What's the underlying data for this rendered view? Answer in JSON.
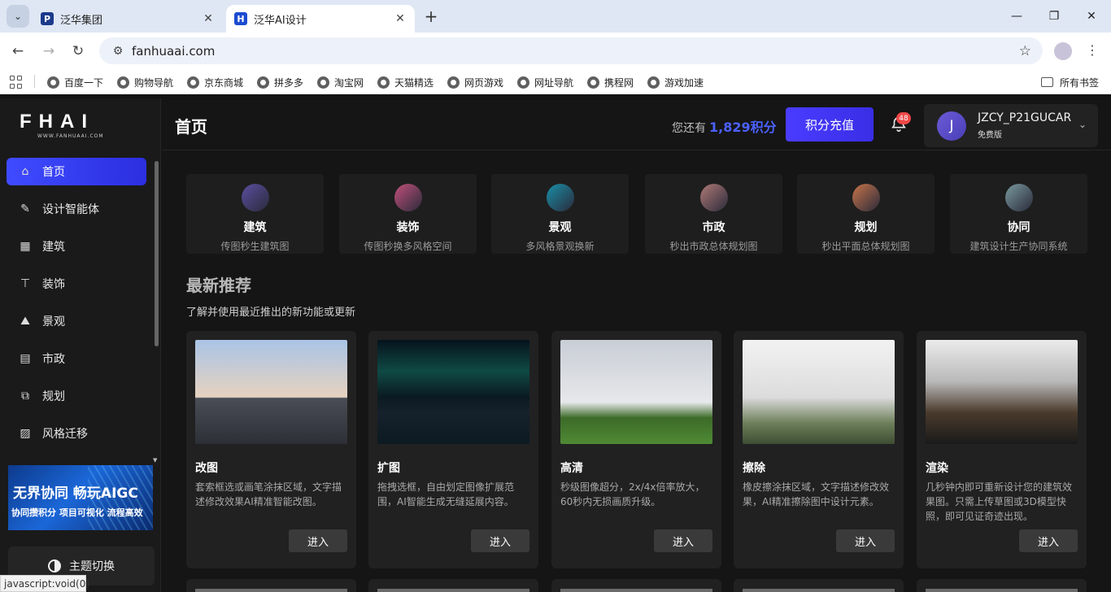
{
  "browser": {
    "tabs": [
      {
        "title": "泛华集团",
        "fav": "P"
      },
      {
        "title": "泛华AI设计",
        "fav": "H"
      }
    ],
    "url": "fanhuaai.com",
    "bookmarks": [
      "百度一下",
      "购物导航",
      "京东商城",
      "拼多多",
      "淘宝网",
      "天猫精选",
      "网页游戏",
      "网址导航",
      "携程网",
      "游戏加速"
    ],
    "all_bookmarks": "所有书签",
    "status_url": "javascript:void(0)"
  },
  "app": {
    "logo_main": "FHAI",
    "logo_sub": "WWW.FANHUAAI.COM",
    "nav": [
      {
        "label": "首页",
        "icon": "home-icon"
      },
      {
        "label": "设计智能体",
        "icon": "edit-doc-icon"
      },
      {
        "label": "建筑",
        "icon": "building-icon"
      },
      {
        "label": "装饰",
        "icon": "paint-roller-icon"
      },
      {
        "label": "景观",
        "icon": "landscape-icon"
      },
      {
        "label": "市政",
        "icon": "city-icon"
      },
      {
        "label": "规划",
        "icon": "layers-icon"
      },
      {
        "label": "风格迁移",
        "icon": "image-icon"
      }
    ],
    "banner": {
      "line1": "无界协同 畅玩AIGC",
      "line2": "协同攒积分 项目可视化 流程高效"
    },
    "theme_toggle": "主题切换",
    "header": {
      "page_title": "首页",
      "credits_prefix": "您还有",
      "credits_value": "1,829积分",
      "recharge_label": "积分充值",
      "notification_count": "48",
      "user_initial": "J",
      "username": "JZCY_P21GUCAR",
      "plan": "免费版"
    },
    "categories": [
      {
        "name": "建筑",
        "desc": "传图秒生建筑图",
        "color": "#5a4fa0"
      },
      {
        "name": "装饰",
        "desc": "传图秒换多风格空间",
        "color": "#c2507a"
      },
      {
        "name": "景观",
        "desc": "多风格景观换新",
        "color": "#1a8fa8"
      },
      {
        "name": "市政",
        "desc": "秒出市政总体规划图",
        "color": "#b07a76"
      },
      {
        "name": "规划",
        "desc": "秒出平面总体规划图",
        "color": "#c8744a"
      },
      {
        "name": "协同",
        "desc": "建筑设计生产协同系统",
        "color": "#7a9a9e"
      }
    ],
    "section": {
      "title": "最新推荐",
      "subtitle": "了解并使用最近推出的新功能或更新"
    },
    "cards": [
      {
        "title": "改图",
        "desc": "套索框选或画笔涂抹区域，文字描述修改效果AI精准智能改图。",
        "button": "进入"
      },
      {
        "title": "扩图",
        "desc": "拖拽选框，自由划定图像扩展范围，AI智能生成无缝延展内容。",
        "button": "进入"
      },
      {
        "title": "高清",
        "desc": "秒级图像超分，2x/4x倍率放大，60秒内无损画质升级。",
        "button": "进入"
      },
      {
        "title": "擦除",
        "desc": "橡皮擦涂抹区域，文字描述修改效果，AI精准擦除图中设计元素。",
        "button": "进入"
      },
      {
        "title": "渲染",
        "desc": "几秒钟内即可重新设计您的建筑效果图。只需上传草图或3D模型快照，即可见证奇迹出现。",
        "button": "进入"
      }
    ]
  }
}
